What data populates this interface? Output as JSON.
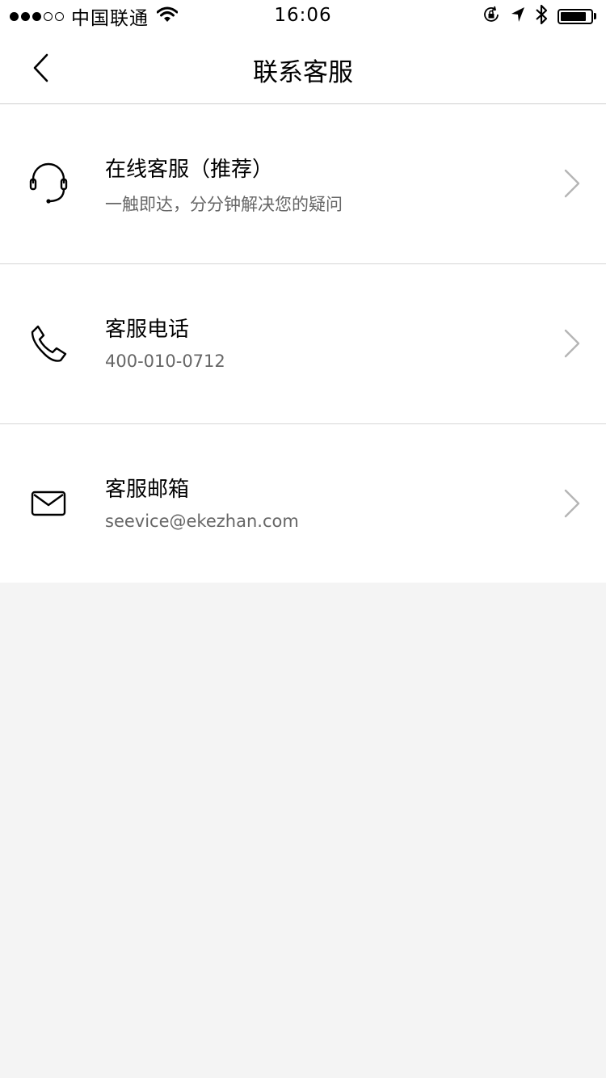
{
  "status_bar": {
    "carrier": "中国联通",
    "time": "16:06",
    "signal_strength": 3,
    "signal_max": 5,
    "battery_level": 0.85
  },
  "nav": {
    "back_icon": "chevron-left-icon",
    "title": "联系客服"
  },
  "contacts": [
    {
      "icon": "headset-icon",
      "title": "在线客服（推荐）",
      "subtitle": "一触即达，分分钟解决您的疑问"
    },
    {
      "icon": "phone-icon",
      "title": "客服电话",
      "subtitle": "400-010-0712"
    },
    {
      "icon": "mail-icon",
      "title": "客服邮箱",
      "subtitle": "seevice@ekezhan.com"
    }
  ],
  "colors": {
    "page_background": "#f4f4f4",
    "card_background": "#ffffff",
    "divider": "#d6d6d6",
    "subtitle_text": "#666666",
    "chevron": "#b5b5b5"
  }
}
